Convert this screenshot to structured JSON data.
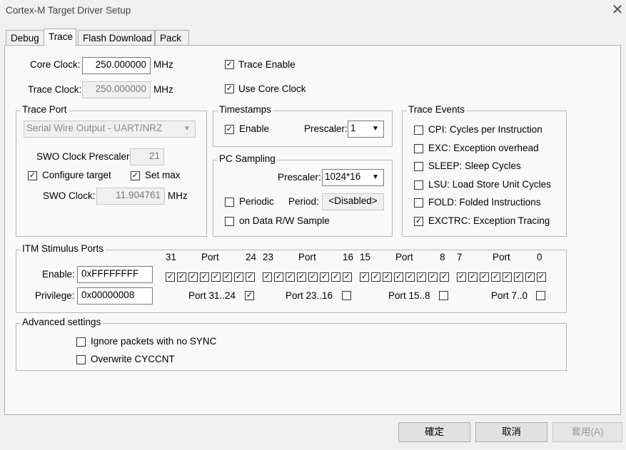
{
  "window": {
    "title": "Cortex-M Target Driver Setup",
    "close_glyph": "✕"
  },
  "tabs": [
    {
      "label": "Debug"
    },
    {
      "label": "Trace"
    },
    {
      "label": "Flash Download"
    },
    {
      "label": "Pack"
    }
  ],
  "top": {
    "core_clock_label": "Core Clock:",
    "core_clock_value": "250.000000",
    "core_clock_unit": "MHz",
    "trace_clock_label": "Trace Clock:",
    "trace_clock_value": "250.000000",
    "trace_clock_unit": "MHz",
    "trace_enable_label": "Trace Enable",
    "trace_enable_checked": true,
    "use_core_clock_label": "Use Core Clock",
    "use_core_clock_checked": true
  },
  "trace_port": {
    "title": "Trace Port",
    "mode": "Serial Wire Output - UART/NRZ",
    "swo_prescaler_label": "SWO Clock Prescaler:",
    "swo_prescaler_value": "21",
    "configure_target_label": "Configure target",
    "configure_target_checked": true,
    "set_max_label": "Set max",
    "set_max_checked": true,
    "swo_clock_label": "SWO Clock:",
    "swo_clock_value": "11.904761",
    "swo_clock_unit": "MHz"
  },
  "timestamps": {
    "title": "Timestamps",
    "enable_label": "Enable",
    "enable_checked": true,
    "prescaler_label": "Prescaler:",
    "prescaler_value": "1"
  },
  "pc_sampling": {
    "title": "PC Sampling",
    "prescaler_label": "Prescaler:",
    "prescaler_value": "1024*16",
    "periodic_label": "Periodic",
    "periodic_checked": false,
    "period_label": "Period:",
    "period_value": "<Disabled>",
    "data_rw_label": "on Data R/W Sample",
    "data_rw_checked": false
  },
  "trace_events": {
    "title": "Trace Events",
    "items": [
      {
        "label": "CPI: Cycles per Instruction",
        "checked": false
      },
      {
        "label": "EXC: Exception overhead",
        "checked": false
      },
      {
        "label": "SLEEP: Sleep Cycles",
        "checked": false
      },
      {
        "label": "LSU: Load Store Unit Cycles",
        "checked": false
      },
      {
        "label": "FOLD: Folded Instructions",
        "checked": false
      },
      {
        "label": "EXCTRC: Exception Tracing",
        "checked": true
      }
    ]
  },
  "itm": {
    "title": "ITM Stimulus Ports",
    "enable_label": "Enable:",
    "enable_value": "0xFFFFFFFF",
    "privilege_label": "Privilege:",
    "privilege_value": "0x00000008",
    "groups": [
      {
        "hi": "31",
        "port": "Port",
        "lo": "24",
        "priv_label": "Port 31..24",
        "priv_checked": true
      },
      {
        "hi": "23",
        "port": "Port",
        "lo": "16",
        "priv_label": "Port 23..16",
        "priv_checked": false
      },
      {
        "hi": "15",
        "port": "Port",
        "lo": "8",
        "priv_label": "Port 15..8",
        "priv_checked": false
      },
      {
        "hi": "7",
        "port": "Port",
        "lo": "0",
        "priv_label": "Port 7..0",
        "priv_checked": false
      }
    ]
  },
  "advanced": {
    "title": "Advanced settings",
    "ignore_label": "Ignore packets with no SYNC",
    "ignore_checked": false,
    "overwrite_label": "Overwrite CYCCNT",
    "overwrite_checked": false
  },
  "buttons": {
    "ok": "確定",
    "cancel": "取消",
    "apply": "套用(A)"
  },
  "check_glyph": "✓"
}
